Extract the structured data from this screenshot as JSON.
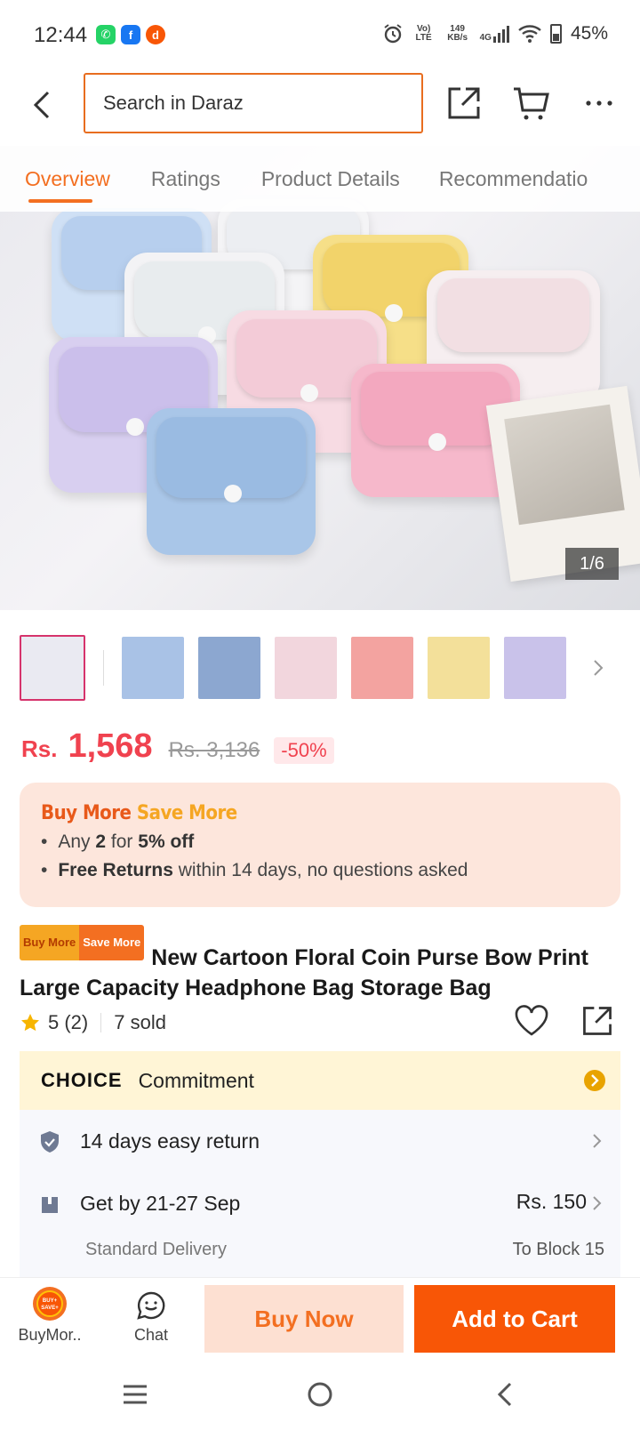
{
  "status_bar": {
    "time": "12:44",
    "apps": [
      "whatsapp-icon",
      "facebook-icon",
      "daraz-icon"
    ],
    "volte": "Vo) LTE",
    "speed": "149 KB/s",
    "network": "4G",
    "battery": "45%"
  },
  "header": {
    "search_placeholder": "Search in Daraz"
  },
  "tabs": [
    {
      "label": "Overview",
      "active": true
    },
    {
      "label": "Ratings",
      "active": false
    },
    {
      "label": "Product Details",
      "active": false
    },
    {
      "label": "Recommendatio",
      "active": false
    }
  ],
  "gallery": {
    "counter": "1/6"
  },
  "thumbnail_colors": [
    "#eaeaf2",
    "#a9c2e6",
    "#8ca7d0",
    "#f2d6dd",
    "#f3a3a0",
    "#f3e09a",
    "#c9c2ea"
  ],
  "price": {
    "currency": "Rs.",
    "current": "1,568",
    "original": "Rs. 3,136",
    "discount": "-50%"
  },
  "promo": {
    "title_a": "Buy More",
    "title_b": "Save More",
    "line1_pre": "Any",
    "line1_qty": "2",
    "line1_mid": "for",
    "line1_off": "5% off",
    "line2_bold": "Free Returns",
    "line2_rest": "within 14 days, no questions asked"
  },
  "product": {
    "badge_a": "Buy More",
    "badge_b": "Save More",
    "title": "New Cartoon Floral Coin Purse Bow Print Large Capacity Headphone Bag Storage Bag",
    "rating": "5 (2)",
    "sold": "7 sold"
  },
  "choice": {
    "logo": "CHOICE",
    "text": "Commitment"
  },
  "services": {
    "returns": "14 days easy return",
    "delivery_title": "Get by 21-27 Sep",
    "delivery_type": "Standard Delivery",
    "delivery_fee": "Rs. 150",
    "delivery_to": "To Block 15"
  },
  "bottom_bar": {
    "buymore_label": "BuyMor..",
    "buymore_badge": "BUY+ SAVE+",
    "chat_label": "Chat",
    "buy_now": "Buy Now",
    "add_to_cart": "Add to Cart"
  },
  "colors": {
    "accent": "#f36f21",
    "price": "#f0424f",
    "add_to_cart": "#f85606"
  }
}
